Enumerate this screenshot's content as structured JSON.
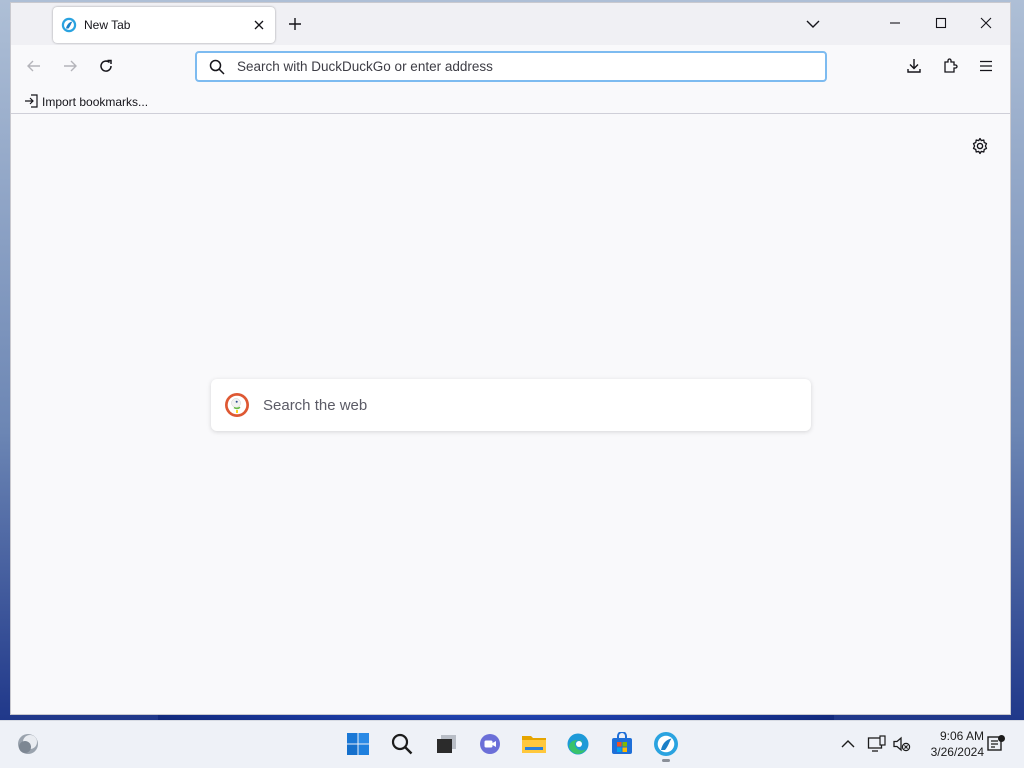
{
  "browser": {
    "tab": {
      "title": "New Tab",
      "favicon": "firefox-icon"
    },
    "titlebar_buttons": [
      "minimize-icon",
      "maximize-icon",
      "close-icon"
    ],
    "navbar": {
      "back_icon": "arrow-left-icon",
      "forward_icon": "arrow-right-icon",
      "reload_icon": "reload-icon",
      "address_placeholder": "Search with DuckDuckGo or enter address",
      "right_icons": [
        "download-icon",
        "extensions-icon",
        "menu-icon"
      ]
    },
    "bookmarks_toolbar": {
      "import_label": "Import bookmarks..."
    },
    "content": {
      "search_placeholder": "Search the web",
      "search_engine_icon": "duckduckgo-icon",
      "settings_icon": "gear-icon"
    },
    "colors": {
      "accent": "#7dbbf0",
      "page_bg": "#f9f9fb",
      "titlebar_bg": "#f0f0f4"
    }
  },
  "taskbar": {
    "apps": [
      "widgets-icon",
      "windows-start-icon",
      "search-icon",
      "task-view-icon",
      "chat-icon",
      "file-explorer-icon",
      "edge-icon",
      "store-icon",
      "firefox-icon"
    ],
    "tray": [
      "chevron-up-icon",
      "network-icon",
      "volume-muted-icon"
    ],
    "clock": {
      "time": "9:06 AM",
      "date": "3/26/2024"
    },
    "notification_icon": "notification-icon"
  }
}
